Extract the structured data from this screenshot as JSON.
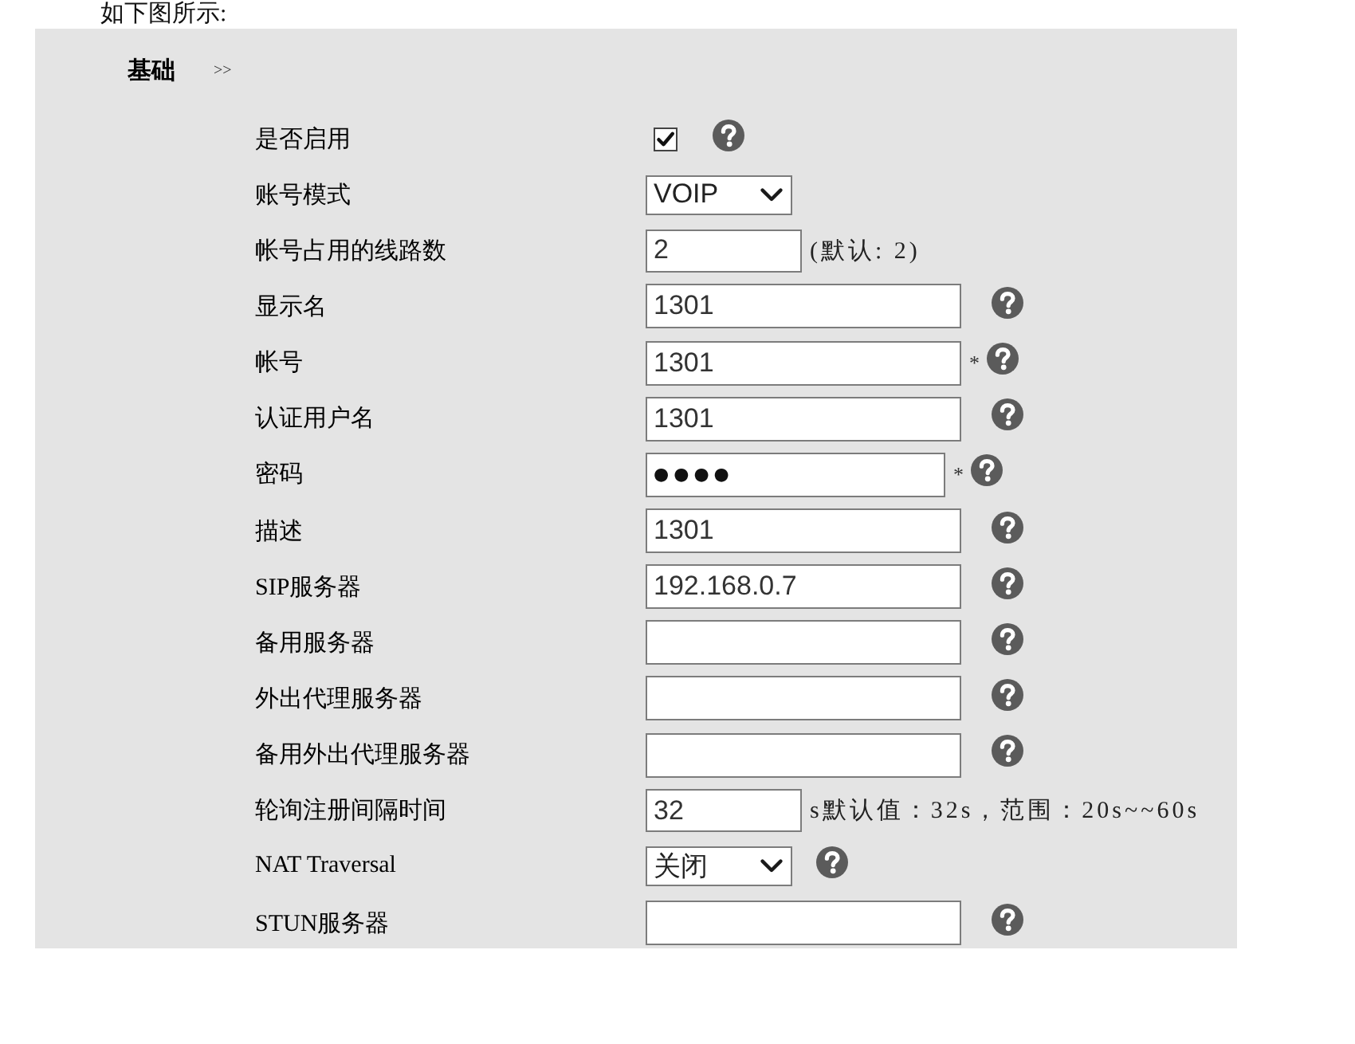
{
  "intro": {
    "text": "如下图所示:"
  },
  "section": {
    "title": "基础",
    "toggle": ">>"
  },
  "fields": [
    {
      "kind": "checkbox",
      "label": "是否启用",
      "checked": true,
      "help": true
    },
    {
      "kind": "select",
      "label": "账号模式",
      "value": "VOIP"
    },
    {
      "kind": "number",
      "label": "帐号占用的线路数",
      "value": "2",
      "note": "(默认: 2)"
    },
    {
      "kind": "text",
      "label": "显示名",
      "value": "1301",
      "help": true
    },
    {
      "kind": "text",
      "label": "帐号",
      "value": "1301",
      "required_mark": "*",
      "help": true
    },
    {
      "kind": "text",
      "label": "认证用户名",
      "value": "1301",
      "help": true
    },
    {
      "kind": "password",
      "label": "密码",
      "value": "●●●●",
      "required_mark": "*",
      "help": true
    },
    {
      "kind": "text",
      "label": "描述",
      "value": "1301",
      "help": true
    },
    {
      "kind": "text",
      "label": "SIP服务器",
      "value": "192.168.0.7",
      "help": true
    },
    {
      "kind": "text",
      "label": "备用服务器",
      "help": true
    },
    {
      "kind": "text",
      "label": "外出代理服务器",
      "help": true
    },
    {
      "kind": "text",
      "label": "备用外出代理服务器",
      "help": true
    },
    {
      "kind": "number",
      "label": "轮询注册间隔时间",
      "value": "32",
      "note": "s默认值：32s，范围：20s~~60s"
    },
    {
      "kind": "select",
      "label": "NAT Traversal",
      "value": "关闭",
      "help": true
    },
    {
      "kind": "text",
      "label": "STUN服务器",
      "help": true
    }
  ]
}
